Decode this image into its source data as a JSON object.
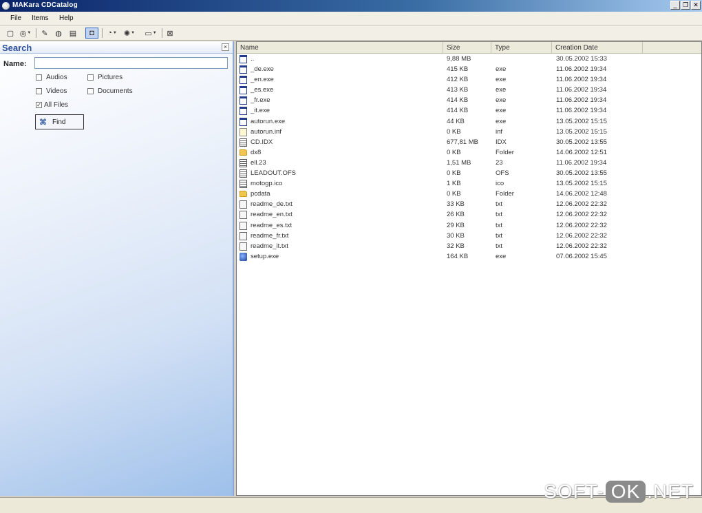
{
  "window": {
    "title": "MAKara CDCatalog"
  },
  "menu": [
    "File",
    "Items",
    "Help"
  ],
  "search": {
    "title": "Search",
    "name_label": "Name:",
    "name_value": "",
    "checkboxes": [
      {
        "label": "Audios",
        "checked": false
      },
      {
        "label": "Pictures",
        "checked": false
      },
      {
        "label": "Videos",
        "checked": false
      },
      {
        "label": "Documents",
        "checked": false
      },
      {
        "label": "All Files",
        "checked": true
      }
    ],
    "find_label": "Find"
  },
  "list": {
    "columns": [
      "Name",
      "Size",
      "Type",
      "Creation Date"
    ],
    "rows": [
      {
        "icon": "exe",
        "name": "..",
        "size": "9,88 MB",
        "type": "",
        "date": "30.05.2002 15:33"
      },
      {
        "icon": "exe",
        "name": "_de.exe",
        "size": "415 KB",
        "type": "exe",
        "date": "11.06.2002 19:34"
      },
      {
        "icon": "exe",
        "name": "_en.exe",
        "size": "412 KB",
        "type": "exe",
        "date": "11.06.2002 19:34"
      },
      {
        "icon": "exe",
        "name": "_es.exe",
        "size": "413 KB",
        "type": "exe",
        "date": "11.06.2002 19:34"
      },
      {
        "icon": "exe",
        "name": "_fr.exe",
        "size": "414 KB",
        "type": "exe",
        "date": "11.06.2002 19:34"
      },
      {
        "icon": "exe",
        "name": "_it.exe",
        "size": "414 KB",
        "type": "exe",
        "date": "11.06.2002 19:34"
      },
      {
        "icon": "exe",
        "name": "autorun.exe",
        "size": "44 KB",
        "type": "exe",
        "date": "13.05.2002 15:15"
      },
      {
        "icon": "inf",
        "name": "autorun.inf",
        "size": "0 KB",
        "type": "inf",
        "date": "13.05.2002 15:15"
      },
      {
        "icon": "img",
        "name": "CD.IDX",
        "size": "677,81 MB",
        "type": "IDX",
        "date": "30.05.2002 13:55"
      },
      {
        "icon": "folder",
        "name": "dx8",
        "size": "0 KB",
        "type": "Folder",
        "date": "14.06.2002 12:51"
      },
      {
        "icon": "img",
        "name": "ell.23",
        "size": "1,51 MB",
        "type": "23",
        "date": "11.06.2002 19:34"
      },
      {
        "icon": "img",
        "name": "LEADOUT.OFS",
        "size": "0 KB",
        "type": "OFS",
        "date": "30.05.2002 13:55"
      },
      {
        "icon": "img",
        "name": "motogp.ico",
        "size": "1 KB",
        "type": "ico",
        "date": "13.05.2002 15:15"
      },
      {
        "icon": "folder",
        "name": "pcdata",
        "size": "0 KB",
        "type": "Folder",
        "date": "14.06.2002 12:48"
      },
      {
        "icon": "doc",
        "name": "readme_de.txt",
        "size": "33 KB",
        "type": "txt",
        "date": "12.06.2002 22:32"
      },
      {
        "icon": "doc",
        "name": "readme_en.txt",
        "size": "26 KB",
        "type": "txt",
        "date": "12.06.2002 22:32"
      },
      {
        "icon": "doc",
        "name": "readme_es.txt",
        "size": "29 KB",
        "type": "txt",
        "date": "12.06.2002 22:32"
      },
      {
        "icon": "doc",
        "name": "readme_fr.txt",
        "size": "30 KB",
        "type": "txt",
        "date": "12.06.2002 22:32"
      },
      {
        "icon": "doc",
        "name": "readme_it.txt",
        "size": "32 KB",
        "type": "txt",
        "date": "12.06.2002 22:32"
      },
      {
        "icon": "setup",
        "name": "setup.exe",
        "size": "164 KB",
        "type": "exe",
        "date": "07.06.2002 15:45"
      }
    ]
  },
  "watermark": {
    "left": "SOFT-",
    "ok": "OK",
    "right": ".NET"
  }
}
